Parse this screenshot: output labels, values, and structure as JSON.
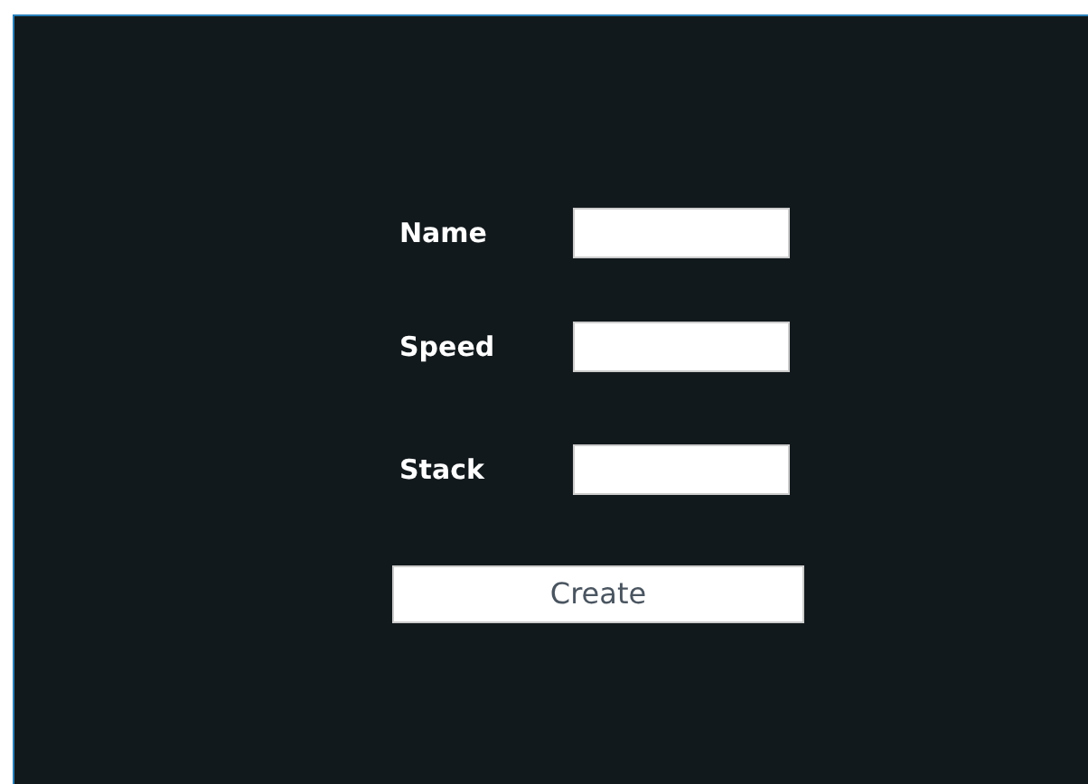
{
  "form": {
    "fields": [
      {
        "label": "Name"
      },
      {
        "label": "Speed"
      },
      {
        "label": "Stack"
      }
    ],
    "button": "Create"
  }
}
